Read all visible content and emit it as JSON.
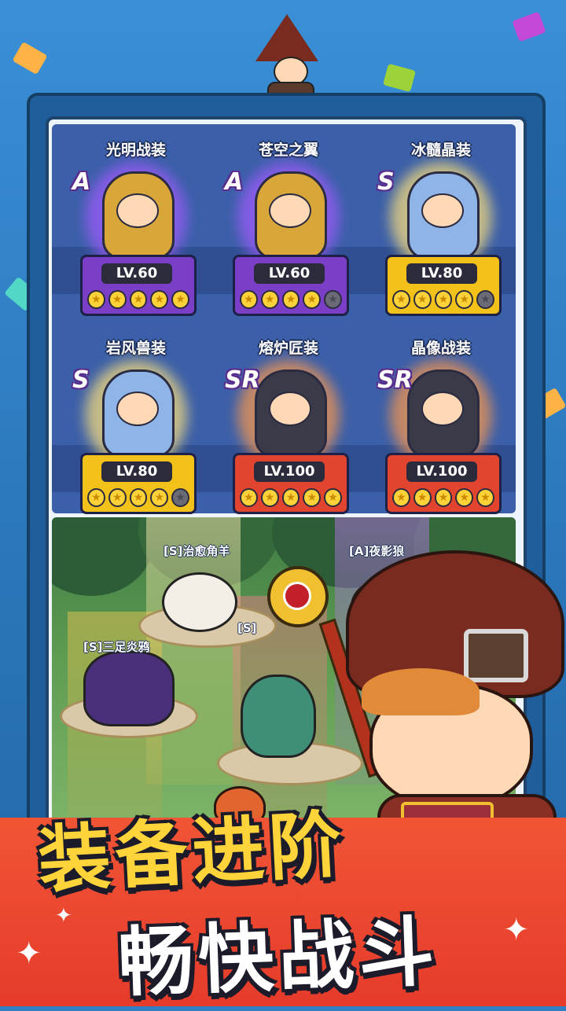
{
  "equipment_cards": [
    {
      "name": "光明战装",
      "rank": "A",
      "level": "LV.60",
      "stars": 5,
      "max_stars": 5,
      "theme": "purple"
    },
    {
      "name": "苍空之翼",
      "rank": "A",
      "level": "LV.60",
      "stars": 4,
      "max_stars": 5,
      "theme": "purple"
    },
    {
      "name": "冰髓晶装",
      "rank": "S",
      "level": "LV.80",
      "stars": 4,
      "max_stars": 5,
      "theme": "gold"
    },
    {
      "name": "岩风兽装",
      "rank": "S",
      "level": "LV.80",
      "stars": 4,
      "max_stars": 5,
      "theme": "gold"
    },
    {
      "name": "熔炉匠装",
      "rank": "SR",
      "level": "LV.100",
      "stars": 5,
      "max_stars": 5,
      "theme": "red"
    },
    {
      "name": "晶像战装",
      "rank": "SR",
      "level": "LV.100",
      "stars": 5,
      "max_stars": 5,
      "theme": "red"
    }
  ],
  "pets": [
    {
      "label": "[S]治愈角羊"
    },
    {
      "label": "[A]夜影狼"
    },
    {
      "label": "[S]三足炎鸦"
    },
    {
      "label": "[S]"
    }
  ],
  "slogan": {
    "line1": "装备进阶",
    "line2": "畅快战斗"
  },
  "colors": {
    "purple_plate": "#7b3fc7",
    "gold_plate": "#f2c21b",
    "red_plate": "#e2452f",
    "accent_yellow": "#ffd43a",
    "background_blue": "#2f7fc4"
  }
}
